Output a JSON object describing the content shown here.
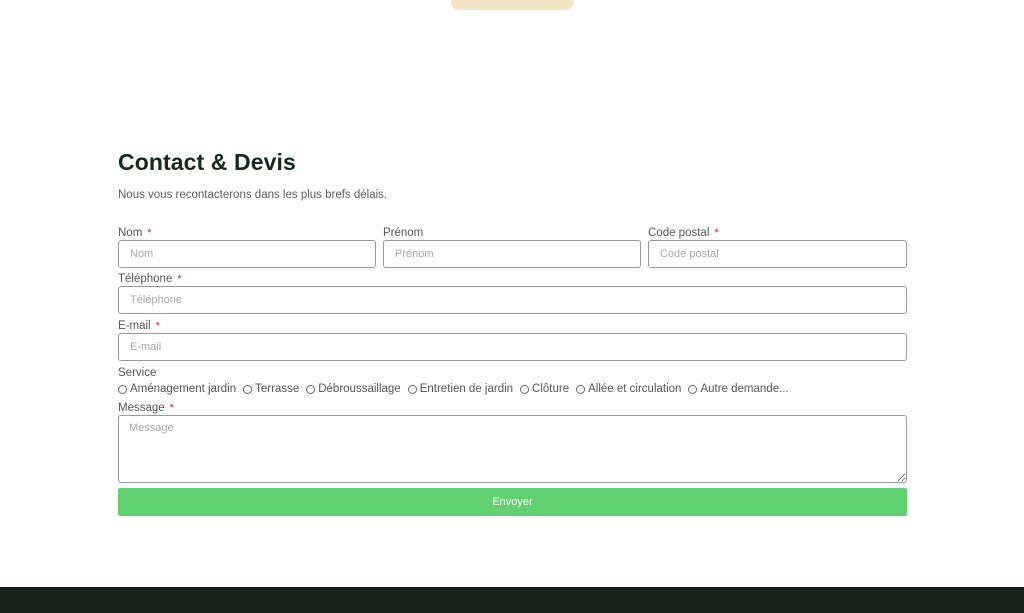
{
  "form": {
    "title": "Contact & Devis",
    "subtitle": "Nous vous recontacterons dans les plus brefs délais.",
    "required_mark": "*",
    "fields": {
      "nom": {
        "label": "Nom",
        "placeholder": "Nom",
        "value": ""
      },
      "prenom": {
        "label": "Prénom",
        "placeholder": "Prénom",
        "value": ""
      },
      "code_postal": {
        "label": "Code postal",
        "placeholder": "Code postal",
        "value": ""
      },
      "telephone": {
        "label": "Téléphone",
        "placeholder": "Téléphone",
        "value": ""
      },
      "email": {
        "label": "E-mail",
        "placeholder": "E-mail",
        "value": ""
      },
      "message": {
        "label": "Message",
        "placeholder": "Message",
        "value": ""
      }
    },
    "service": {
      "label": "Service",
      "options": [
        "Aménagement jardin",
        "Terrasse",
        "Débroussaillage",
        "Entretien de jardin",
        "Clôture",
        "Allée et circulation",
        "Autre demande..."
      ]
    },
    "submit_label": "Envoyer"
  },
  "colors": {
    "accent_button": "#62d171",
    "title": "#17291f",
    "required": "#e11d1d",
    "footer": "#14231c",
    "top_tab": "#f3e4c6"
  }
}
